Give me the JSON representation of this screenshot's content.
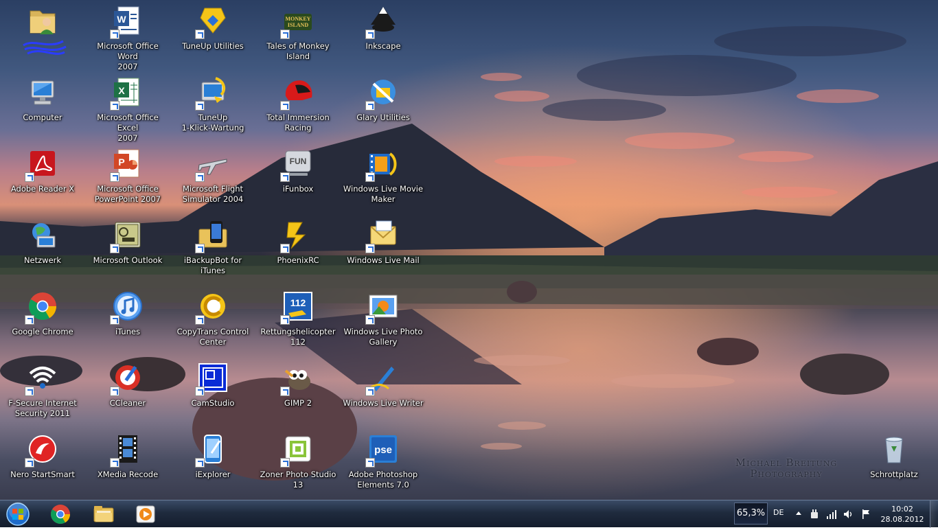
{
  "desktop": {
    "watermark_line1": "Michael Breitung",
    "watermark_line2": "Photography",
    "icons": [
      {
        "label": "",
        "icon": "user-folder-icon",
        "shortcut": false
      },
      {
        "label": "Computer",
        "icon": "computer-icon",
        "shortcut": false
      },
      {
        "label": "Adobe Reader X",
        "icon": "adobe-reader-icon",
        "shortcut": true
      },
      {
        "label": "Netzwerk",
        "icon": "network-icon",
        "shortcut": false
      },
      {
        "label": "Google Chrome",
        "icon": "chrome-icon",
        "shortcut": true
      },
      {
        "label": "F-Secure Internet\nSecurity 2011",
        "icon": "fsecure-icon",
        "shortcut": true
      },
      {
        "label": "Nero StartSmart",
        "icon": "nero-icon",
        "shortcut": true
      },
      {
        "label": "Microsoft Office Word\n2007",
        "icon": "word-icon",
        "shortcut": true
      },
      {
        "label": "Microsoft Office Excel\n2007",
        "icon": "excel-icon",
        "shortcut": true
      },
      {
        "label": "Microsoft Office\nPowerPoint 2007",
        "icon": "powerpoint-icon",
        "shortcut": true
      },
      {
        "label": "Microsoft Outlook",
        "icon": "outlook-icon",
        "shortcut": true
      },
      {
        "label": "iTunes",
        "icon": "itunes-icon",
        "shortcut": true
      },
      {
        "label": "CCleaner",
        "icon": "ccleaner-icon",
        "shortcut": true
      },
      {
        "label": "XMedia Recode",
        "icon": "film-icon",
        "shortcut": true
      },
      {
        "label": "TuneUp Utilities",
        "icon": "tuneup-icon",
        "shortcut": true
      },
      {
        "label": "TuneUp\n1-Klick-Wartung",
        "icon": "tuneup-1click-icon",
        "shortcut": true
      },
      {
        "label": "Microsoft Flight\nSimulator 2004",
        "icon": "airplane-icon",
        "shortcut": true
      },
      {
        "label": "iBackupBot for iTunes",
        "icon": "ibackupbot-icon",
        "shortcut": true
      },
      {
        "label": "CopyTrans Control\nCenter",
        "icon": "copytrans-icon",
        "shortcut": true
      },
      {
        "label": "CamStudio",
        "icon": "camstudio-icon",
        "shortcut": true
      },
      {
        "label": "iExplorer",
        "icon": "iexplorer-icon",
        "shortcut": true
      },
      {
        "label": "Tales of Monkey\nIsland",
        "icon": "monkey-island-icon",
        "shortcut": true
      },
      {
        "label": "Total Immersion\nRacing",
        "icon": "racing-helmet-icon",
        "shortcut": true
      },
      {
        "label": "iFunbox",
        "icon": "ifunbox-icon",
        "shortcut": true
      },
      {
        "label": "PhoenixRC",
        "icon": "phoenixrc-icon",
        "shortcut": true
      },
      {
        "label": "Rettungshelicopter\n112",
        "icon": "rettungshelicopter-icon",
        "shortcut": true
      },
      {
        "label": "GIMP 2",
        "icon": "gimp-icon",
        "shortcut": true
      },
      {
        "label": "Zoner Photo Studio 13",
        "icon": "zoner-icon",
        "shortcut": true
      },
      {
        "label": "Inkscape",
        "icon": "inkscape-icon",
        "shortcut": true
      },
      {
        "label": "Glary Utilities",
        "icon": "glary-icon",
        "shortcut": true
      },
      {
        "label": "Windows Live Movie\nMaker",
        "icon": "movie-maker-icon",
        "shortcut": true
      },
      {
        "label": "Windows Live Mail",
        "icon": "live-mail-icon",
        "shortcut": true
      },
      {
        "label": "Windows Live Photo\nGallery",
        "icon": "photo-gallery-icon",
        "shortcut": true
      },
      {
        "label": "Windows Live Writer",
        "icon": "live-writer-icon",
        "shortcut": true
      },
      {
        "label": "Adobe Photoshop\nElements 7.0",
        "icon": "photoshop-icon",
        "shortcut": true
      },
      {
        "label": "Schrottplatz",
        "icon": "recycle-bin-icon",
        "shortcut": false
      }
    ]
  },
  "taskbar": {
    "pinned": [
      {
        "icon": "chrome-icon"
      },
      {
        "icon": "explorer-icon"
      },
      {
        "icon": "media-player-icon"
      }
    ],
    "battery_percent": "65,3%",
    "language": "DE",
    "time": "10:02",
    "date": "28.08.2012"
  }
}
